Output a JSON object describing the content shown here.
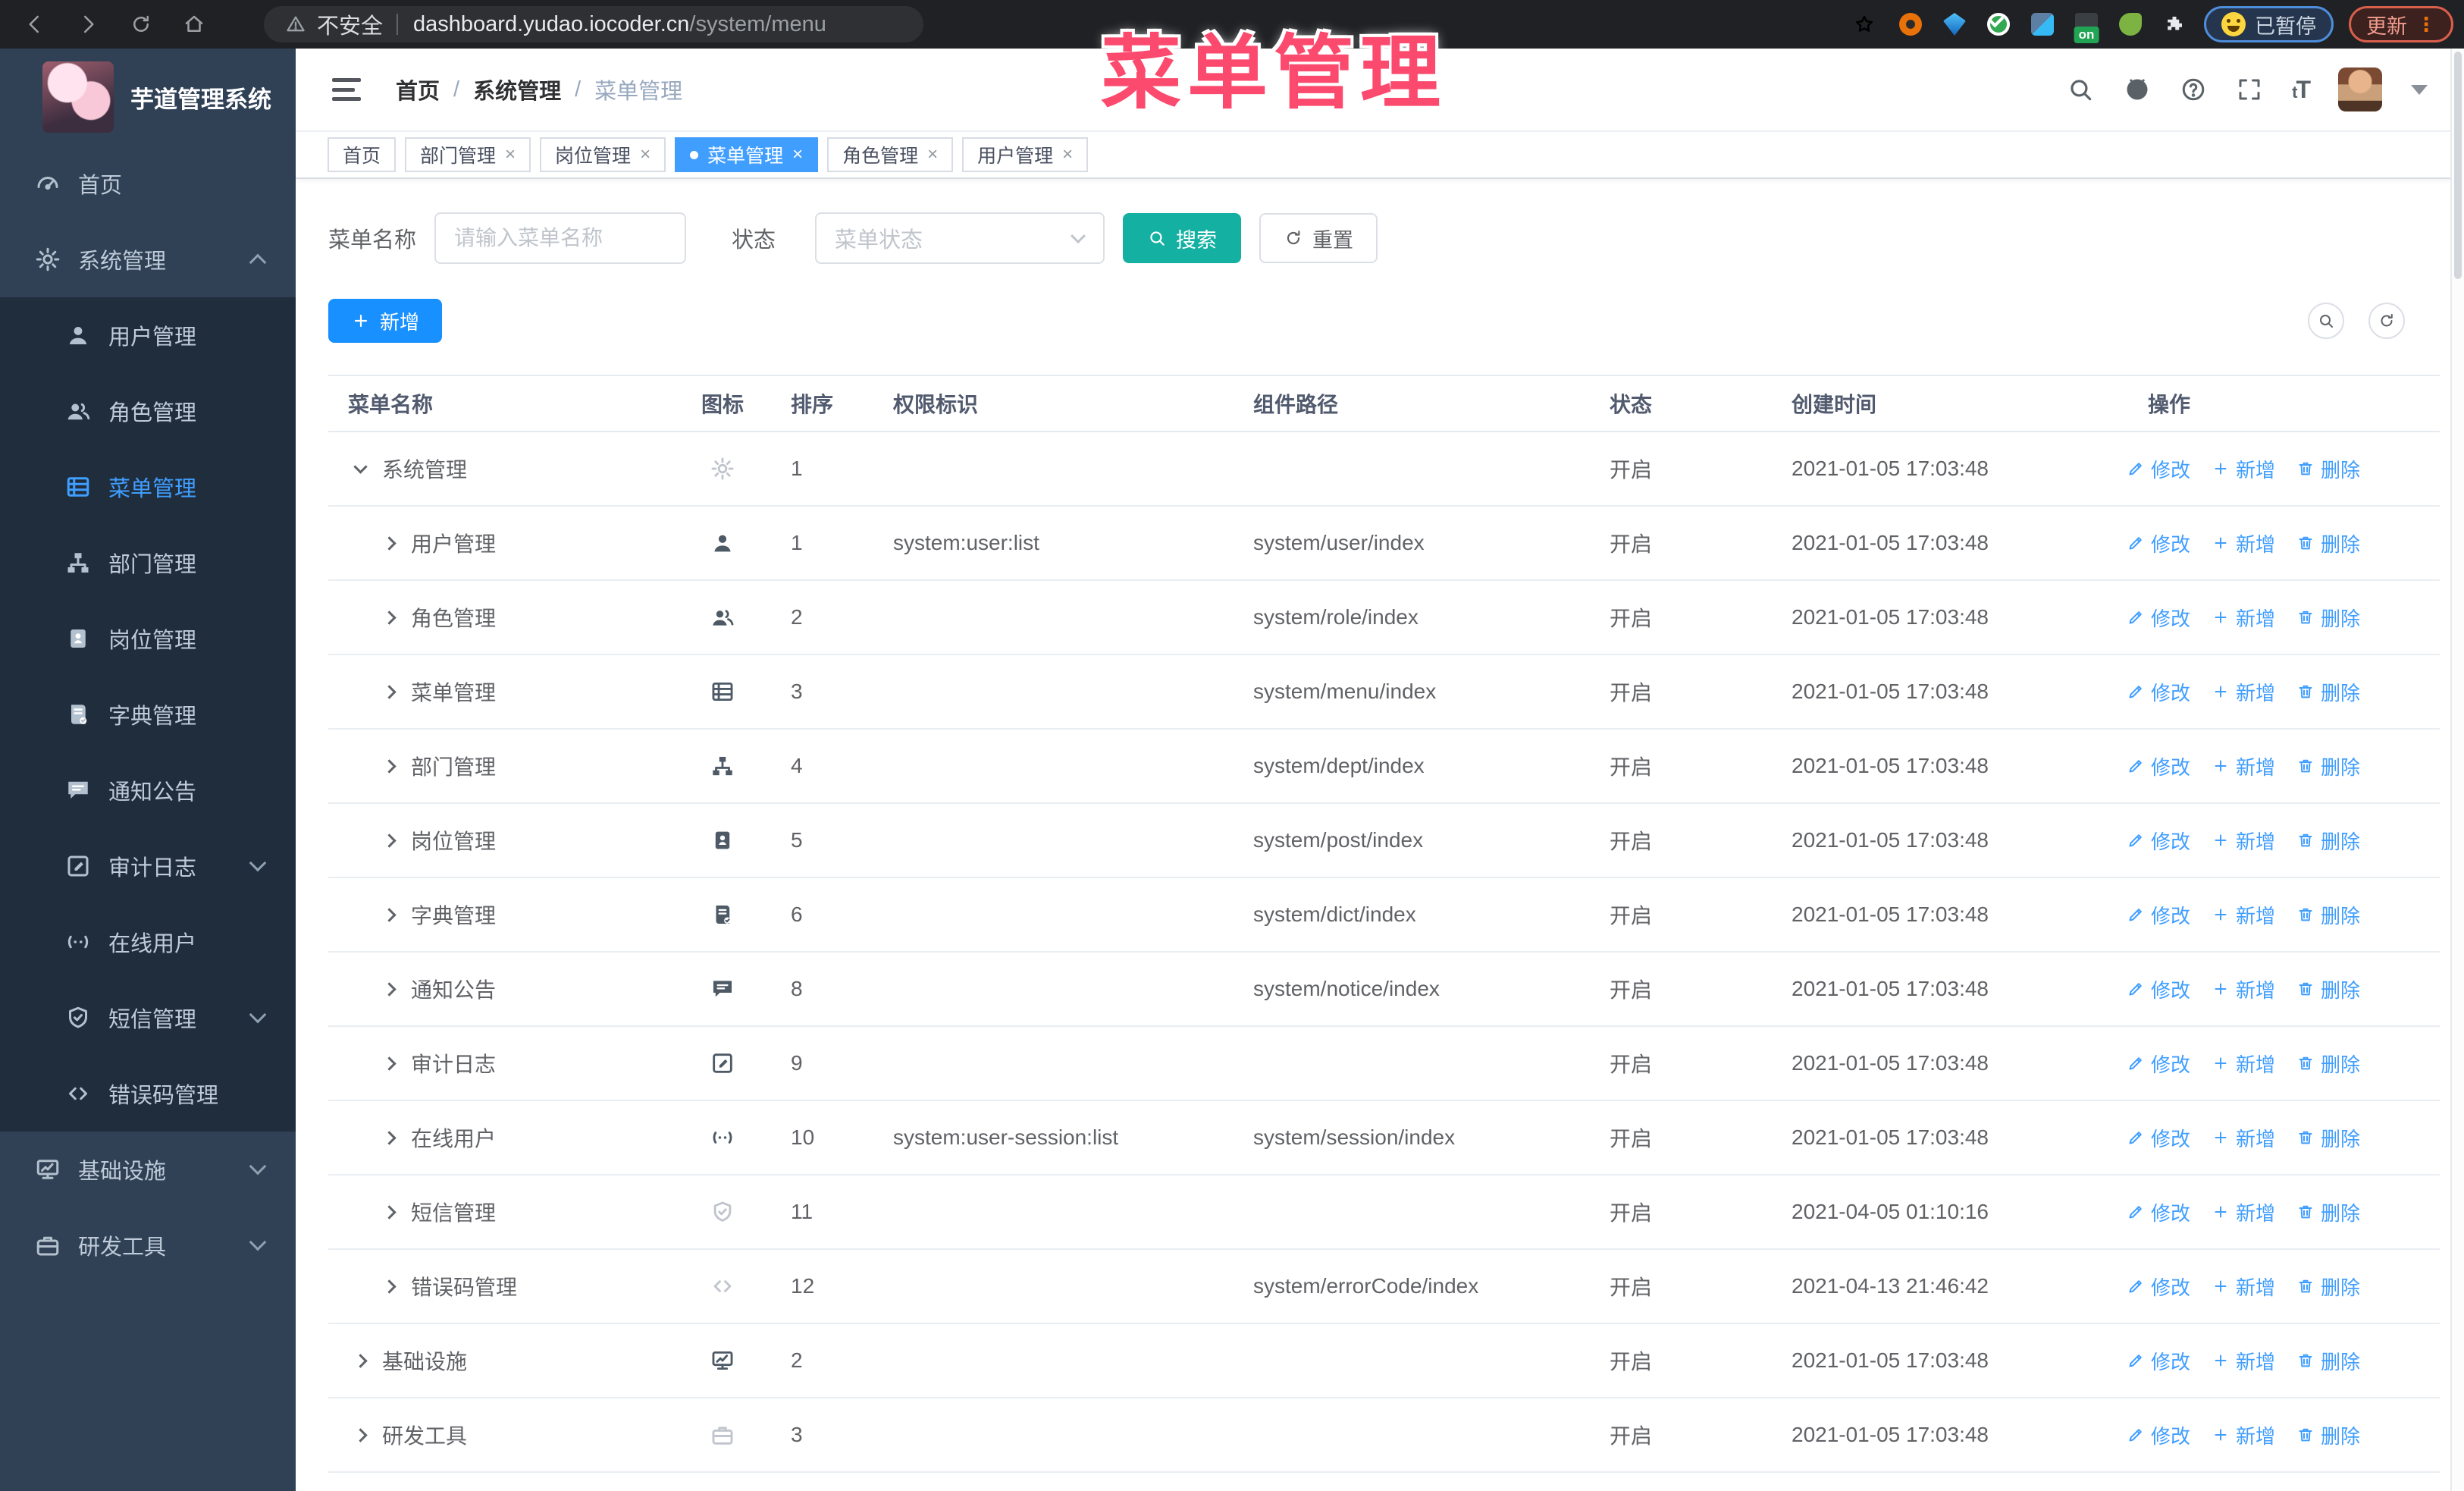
{
  "browser": {
    "security_label": "不安全",
    "url_host": "dashboard.yudao.iocoder.cn",
    "url_path": "/system/menu",
    "paused_label": "已暂停",
    "update_label": "更新"
  },
  "watermark": "菜单管理",
  "sidebar": {
    "title": "芋道管理系统",
    "items": [
      {
        "key": "home",
        "label": "首页",
        "icon": "dashboard",
        "level": 0
      },
      {
        "key": "system",
        "label": "系统管理",
        "icon": "gear",
        "level": 0,
        "chevron": "up"
      },
      {
        "key": "user",
        "label": "用户管理",
        "icon": "user",
        "level": 1
      },
      {
        "key": "role",
        "label": "角色管理",
        "icon": "users",
        "level": 1
      },
      {
        "key": "menu",
        "label": "菜单管理",
        "icon": "menu",
        "level": 1,
        "active": true
      },
      {
        "key": "dept",
        "label": "部门管理",
        "icon": "tree",
        "level": 1
      },
      {
        "key": "post",
        "label": "岗位管理",
        "icon": "post",
        "level": 1
      },
      {
        "key": "dict",
        "label": "字典管理",
        "icon": "dict",
        "level": 1
      },
      {
        "key": "notice",
        "label": "通知公告",
        "icon": "message",
        "level": 1
      },
      {
        "key": "log",
        "label": "审计日志",
        "icon": "log",
        "level": 1,
        "chevron": "down"
      },
      {
        "key": "online",
        "label": "在线用户",
        "icon": "online",
        "level": 1
      },
      {
        "key": "sms",
        "label": "短信管理",
        "icon": "sms",
        "level": 1,
        "chevron": "down"
      },
      {
        "key": "errcode",
        "label": "错误码管理",
        "icon": "code",
        "level": 1
      },
      {
        "key": "infra",
        "label": "基础设施",
        "icon": "infra",
        "level": 0,
        "chevron": "down"
      },
      {
        "key": "tool",
        "label": "研发工具",
        "icon": "tool",
        "level": 0,
        "chevron": "down"
      }
    ]
  },
  "navbar": {
    "breadcrumb": [
      "首页",
      "系统管理",
      "菜单管理"
    ]
  },
  "tabs": [
    {
      "label": "首页",
      "closable": false,
      "active": false
    },
    {
      "label": "部门管理",
      "closable": true,
      "active": false
    },
    {
      "label": "岗位管理",
      "closable": true,
      "active": false
    },
    {
      "label": "菜单管理",
      "closable": true,
      "active": true
    },
    {
      "label": "角色管理",
      "closable": true,
      "active": false
    },
    {
      "label": "用户管理",
      "closable": true,
      "active": false
    }
  ],
  "filter": {
    "name_label": "菜单名称",
    "name_placeholder": "请输入菜单名称",
    "status_label": "状态",
    "status_placeholder": "菜单状态",
    "search_label": "搜索",
    "reset_label": "重置"
  },
  "toolbar": {
    "add_label": "新增"
  },
  "table": {
    "columns": [
      "菜单名称",
      "图标",
      "排序",
      "权限标识",
      "组件路径",
      "状态",
      "创建时间",
      "操作"
    ],
    "action_labels": [
      "修改",
      "新增",
      "删除"
    ],
    "rows": [
      {
        "name": "系统管理",
        "icon": "gear",
        "icon_light": true,
        "level": 0,
        "expanded": true,
        "sort": "1",
        "perm": "",
        "path": "",
        "status": "开启",
        "time": "2021-01-05 17:03:48"
      },
      {
        "name": "用户管理",
        "icon": "user",
        "icon_light": false,
        "level": 1,
        "expanded": false,
        "sort": "1",
        "perm": "system:user:list",
        "path": "system/user/index",
        "status": "开启",
        "time": "2021-01-05 17:03:48"
      },
      {
        "name": "角色管理",
        "icon": "users",
        "icon_light": false,
        "level": 1,
        "expanded": false,
        "sort": "2",
        "perm": "",
        "path": "system/role/index",
        "status": "开启",
        "time": "2021-01-05 17:03:48"
      },
      {
        "name": "菜单管理",
        "icon": "menu",
        "icon_light": false,
        "level": 1,
        "expanded": false,
        "sort": "3",
        "perm": "",
        "path": "system/menu/index",
        "status": "开启",
        "time": "2021-01-05 17:03:48"
      },
      {
        "name": "部门管理",
        "icon": "tree",
        "icon_light": false,
        "level": 1,
        "expanded": false,
        "sort": "4",
        "perm": "",
        "path": "system/dept/index",
        "status": "开启",
        "time": "2021-01-05 17:03:48"
      },
      {
        "name": "岗位管理",
        "icon": "post",
        "icon_light": false,
        "level": 1,
        "expanded": false,
        "sort": "5",
        "perm": "",
        "path": "system/post/index",
        "status": "开启",
        "time": "2021-01-05 17:03:48"
      },
      {
        "name": "字典管理",
        "icon": "dict",
        "icon_light": false,
        "level": 1,
        "expanded": false,
        "sort": "6",
        "perm": "",
        "path": "system/dict/index",
        "status": "开启",
        "time": "2021-01-05 17:03:48"
      },
      {
        "name": "通知公告",
        "icon": "message",
        "icon_light": false,
        "level": 1,
        "expanded": false,
        "sort": "8",
        "perm": "",
        "path": "system/notice/index",
        "status": "开启",
        "time": "2021-01-05 17:03:48"
      },
      {
        "name": "审计日志",
        "icon": "log",
        "icon_light": false,
        "level": 1,
        "expanded": false,
        "sort": "9",
        "perm": "",
        "path": "",
        "status": "开启",
        "time": "2021-01-05 17:03:48"
      },
      {
        "name": "在线用户",
        "icon": "online",
        "icon_light": false,
        "level": 1,
        "expanded": false,
        "sort": "10",
        "perm": "system:user-session:list",
        "path": "system/session/index",
        "status": "开启",
        "time": "2021-01-05 17:03:48"
      },
      {
        "name": "短信管理",
        "icon": "sms",
        "icon_light": true,
        "level": 1,
        "expanded": false,
        "sort": "11",
        "perm": "",
        "path": "",
        "status": "开启",
        "time": "2021-04-05 01:10:16"
      },
      {
        "name": "错误码管理",
        "icon": "code",
        "icon_light": true,
        "level": 1,
        "expanded": false,
        "sort": "12",
        "perm": "",
        "path": "system/errorCode/index",
        "status": "开启",
        "time": "2021-04-13 21:46:42"
      },
      {
        "name": "基础设施",
        "icon": "infra",
        "icon_light": false,
        "level": 0,
        "expanded": false,
        "sort": "2",
        "perm": "",
        "path": "",
        "status": "开启",
        "time": "2021-01-05 17:03:48"
      },
      {
        "name": "研发工具",
        "icon": "tool",
        "icon_light": true,
        "level": 0,
        "expanded": false,
        "sort": "3",
        "perm": "",
        "path": "",
        "status": "开启",
        "time": "2021-01-05 17:03:48"
      }
    ]
  }
}
